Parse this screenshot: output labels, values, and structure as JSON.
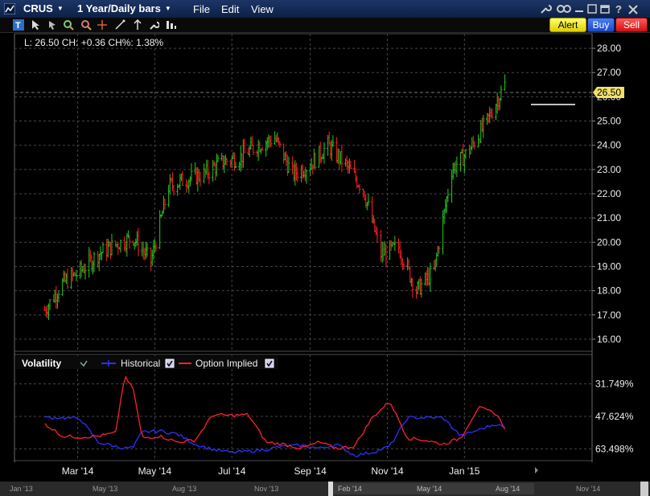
{
  "title_bar": {
    "symbol": "CRUS",
    "period": "1 Year/Daily bars",
    "menus": [
      "File",
      "Edit",
      "View"
    ]
  },
  "actions": {
    "alert": "Alert",
    "buy": "Buy",
    "sell": "Sell"
  },
  "toolbar": {
    "icons": [
      "text-tool-icon",
      "cursor-icon",
      "zoom-icon",
      "zoom-out-icon",
      "crosshair-icon",
      "draw-tool-icon",
      "trend-line-icon",
      "settings-icon",
      "indicator-icon"
    ]
  },
  "price_panel": {
    "readout": "L: 26.50 CH: +0.36 CH%: 1.38%",
    "last_price_label": "26.50",
    "y_ticks": [
      "28.00",
      "27.00",
      "26.00",
      "25.00",
      "24.00",
      "23.00",
      "22.00",
      "21.00",
      "20.00",
      "19.00",
      "18.00",
      "17.00",
      "16.00"
    ]
  },
  "volatility_panel": {
    "title": "Volatility",
    "legend": [
      {
        "name": "Historical",
        "color": "#3030ff"
      },
      {
        "name": "Option Implied",
        "color": "#ff2030"
      }
    ],
    "y_ticks": [
      "63.498%",
      "47.624%",
      "31.749%"
    ]
  },
  "x_axis": {
    "labels": [
      "Mar '14",
      "May '14",
      "Jul '14",
      "Sep '14",
      "Nov '14",
      "Jan '15"
    ]
  },
  "range_bar": {
    "labels": [
      "Jan '13",
      "May '13",
      "Aug '13",
      "Nov '13",
      "Feb '14",
      "May '14",
      "Aug '14",
      "Nov '14"
    ]
  },
  "colors": {
    "up": "#22cc22",
    "down": "#ff2222",
    "last_label_bg": "#f0e068"
  },
  "chart_data": [
    {
      "type": "ohlc",
      "title": "",
      "xlabel": "",
      "ylabel": "",
      "ylim": [
        15.5,
        28.6
      ],
      "x": [
        "2014-02-03",
        "2014-02-17",
        "2014-03-03",
        "2014-03-17",
        "2014-03-31",
        "2014-04-14",
        "2014-04-28",
        "2014-05-12",
        "2014-05-26",
        "2014-06-09",
        "2014-06-23",
        "2014-07-07",
        "2014-07-21",
        "2014-08-04",
        "2014-08-18",
        "2014-09-01",
        "2014-09-15",
        "2014-09-29",
        "2014-10-13",
        "2014-10-27",
        "2014-11-10",
        "2014-11-24",
        "2014-12-08",
        "2014-12-22",
        "2015-01-05",
        "2015-01-19",
        "2015-02-02"
      ],
      "close": [
        17.2,
        18.3,
        18.8,
        19.5,
        19.9,
        20.2,
        19.2,
        22.3,
        22.6,
        22.8,
        23.3,
        23.5,
        24.0,
        24.3,
        22.8,
        23.2,
        24.0,
        23.2,
        22.2,
        19.5,
        19.8,
        18.0,
        18.8,
        23.0,
        23.8,
        25.0,
        26.5
      ]
    },
    {
      "type": "line",
      "title": "",
      "ylim": [
        26,
        70
      ],
      "yticks": [
        31.749,
        47.624,
        63.498
      ],
      "x": [
        "2014-02-03",
        "2014-02-17",
        "2014-03-03",
        "2014-03-17",
        "2014-03-31",
        "2014-04-07",
        "2014-04-14",
        "2014-04-21",
        "2014-05-05",
        "2014-05-19",
        "2014-06-02",
        "2014-06-16",
        "2014-06-30",
        "2014-07-14",
        "2014-07-28",
        "2014-08-11",
        "2014-08-25",
        "2014-09-08",
        "2014-09-22",
        "2014-10-06",
        "2014-10-20",
        "2014-11-03",
        "2014-11-17",
        "2014-12-01",
        "2014-12-15",
        "2014-12-29",
        "2015-01-12",
        "2015-01-26",
        "2015-02-02"
      ],
      "series": [
        {
          "name": "Historical",
          "values": [
            47.0,
            47.0,
            46.5,
            35.0,
            33.0,
            32.0,
            32.5,
            40.0,
            40.5,
            39.0,
            34.0,
            31.5,
            30.0,
            30.5,
            31.5,
            33.0,
            33.5,
            32.0,
            34.0,
            28.5,
            30.0,
            33.0,
            47.0,
            47.0,
            47.0,
            38.0,
            41.0,
            44.0,
            42.0
          ]
        },
        {
          "name": "Option Implied",
          "values": [
            44.0,
            38.0,
            37.5,
            38.0,
            39.5,
            67.0,
            61.0,
            37.0,
            38.0,
            35.0,
            36.0,
            48.5,
            48.0,
            48.5,
            35.0,
            34.0,
            32.0,
            35.0,
            32.0,
            33.0,
            47.0,
            55.0,
            37.0,
            36.0,
            34.0,
            37.0,
            52.0,
            49.0,
            42.0
          ]
        }
      ]
    }
  ]
}
